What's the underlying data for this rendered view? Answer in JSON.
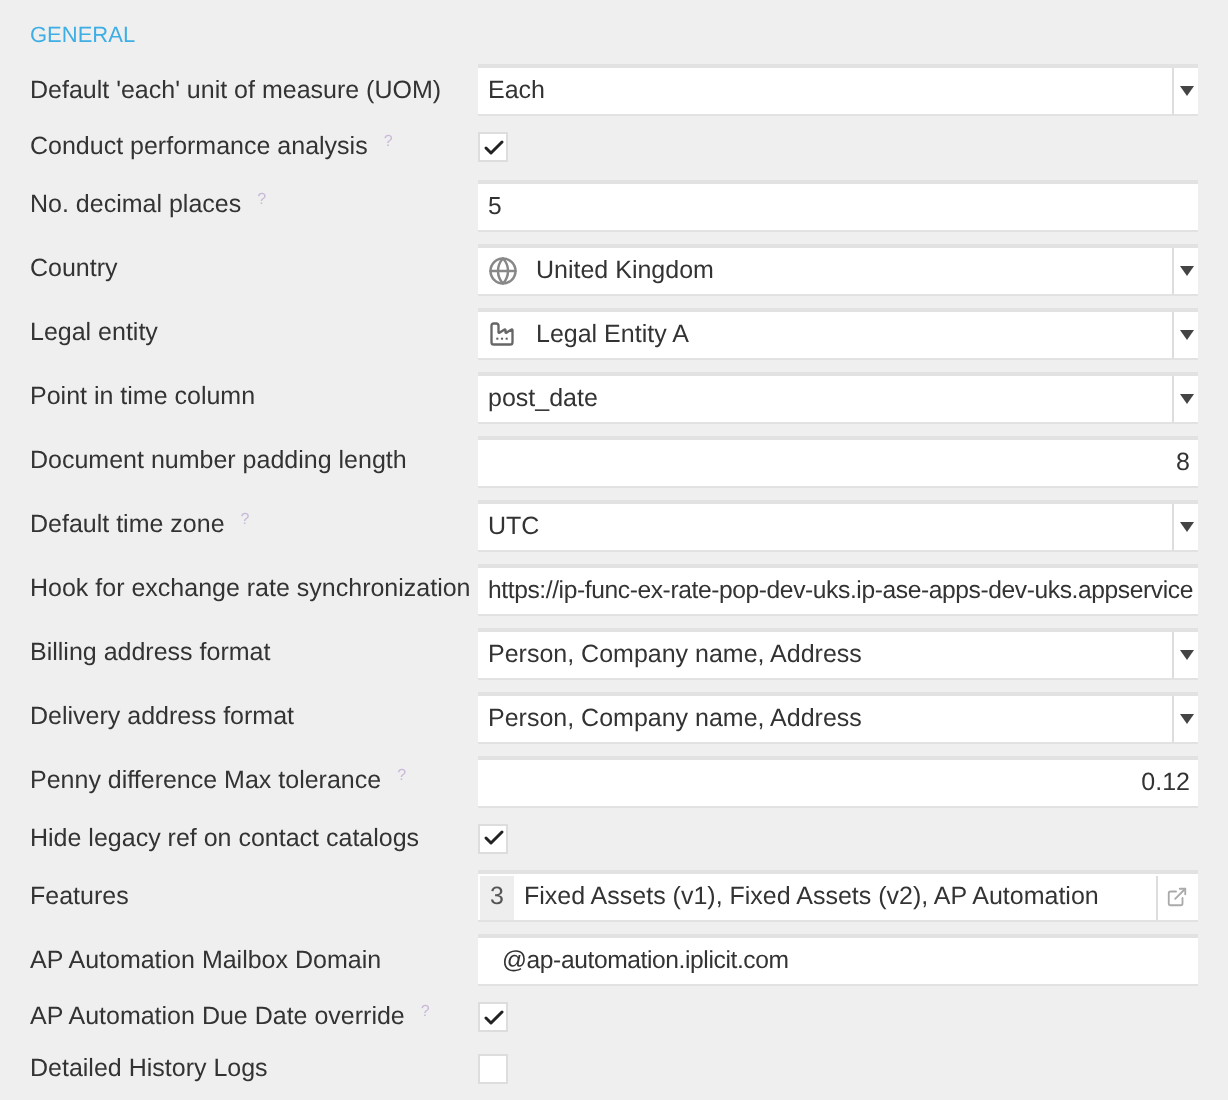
{
  "section_title": "GENERAL",
  "rows": [
    {
      "label": "Default 'each' unit of measure (UOM)",
      "kind": "select",
      "value": "Each"
    },
    {
      "label": "Conduct performance analysis",
      "help": "?",
      "kind": "checkbox",
      "checked": true
    },
    {
      "label": "No. decimal places",
      "help": "?",
      "kind": "text",
      "value": "5"
    },
    {
      "label": "Country",
      "kind": "country",
      "value": "United Kingdom"
    },
    {
      "label": "Legal entity",
      "kind": "entity",
      "value": "Legal Entity A"
    },
    {
      "label": "Point in time column",
      "kind": "select",
      "value": "post_date"
    },
    {
      "label": "Document number padding length",
      "kind": "number",
      "value": "8"
    },
    {
      "label": "Default time zone",
      "help": "?",
      "kind": "select",
      "value": "UTC"
    },
    {
      "label": "Hook for exchange rate synchronization",
      "kind": "text",
      "value": "https://ip-func-ex-rate-pop-dev-uks.ip-ase-apps-dev-uks.appservice"
    },
    {
      "label": "Billing address format",
      "kind": "select",
      "value": "Person, Company name, Address"
    },
    {
      "label": "Delivery address format",
      "kind": "select",
      "value": "Person, Company name, Address"
    },
    {
      "label": "Penny difference Max tolerance",
      "help": "?",
      "kind": "number",
      "value": "0.12"
    },
    {
      "label": "Hide legacy ref on contact catalogs",
      "kind": "checkbox",
      "checked": true
    },
    {
      "label": "Features",
      "kind": "multi",
      "count": "3",
      "value": "Fixed Assets (v1), Fixed Assets (v2), AP Automation"
    },
    {
      "label": "AP Automation Mailbox Domain",
      "kind": "domain",
      "value": "@ap-automation.iplicit.com"
    },
    {
      "label": "AP Automation Due Date override",
      "help": "?",
      "kind": "checkbox",
      "checked": true
    },
    {
      "label": "Detailed History Logs",
      "kind": "checkbox",
      "checked": false
    }
  ]
}
